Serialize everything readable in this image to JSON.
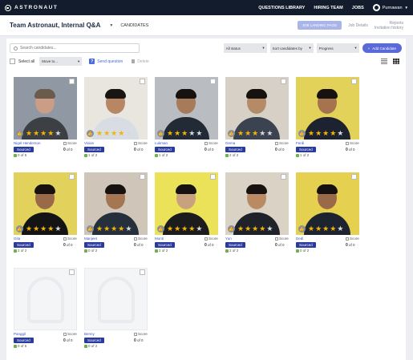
{
  "brand": {
    "name": "ASTRONAUT"
  },
  "topnav": {
    "questions": "QUESTIONS LIBRARY",
    "hiring": "HIRING TEAM",
    "jobs": "JOBS",
    "user": "Purnawan"
  },
  "subheader": {
    "team_title": "Team Astronaut, Internal Q&A",
    "candidates_tab": "CANDIDATES",
    "job_landing": "JOB LANDING PAGE",
    "job_details": "Job Details",
    "reports": "Reports",
    "invitation_history": "Invitation history"
  },
  "toolbar": {
    "search_placeholder": "Search candidates...",
    "status": "All status",
    "sort": "Sort candidates by",
    "progress": "Progress",
    "add": "Add Candidate",
    "select_all": "Select all",
    "move_to": "Move to...",
    "send_question": "Send question",
    "delete": "Delete"
  },
  "card_labels": {
    "status": "Sourced",
    "score": "Score",
    "of": "of 0"
  },
  "candidates": [
    {
      "name": "Nigel Henderson",
      "answered": "0 of 5",
      "score": "0",
      "rating": 4,
      "skin": "#c99d86",
      "shirt": "#3c3f44",
      "bg": "#8f98a3",
      "hair": "#6b5b4a"
    },
    {
      "name": "Vivian",
      "answered": "1 of 2",
      "score": "0",
      "rating": 4,
      "skin": "#b78763",
      "shirt": "#d8dde4",
      "bg": "#e9e5df",
      "hair": "#1a1512"
    },
    {
      "name": "Lukman",
      "answered": "1 of 2",
      "score": "0",
      "rating": 3,
      "skin": "#a77a59",
      "shirt": "#222a36",
      "bg": "#b9bcc0",
      "hair": "#17120f"
    },
    {
      "name": "Gema",
      "answered": "2 of 2",
      "score": "0",
      "rating": 3,
      "skin": "#b58a66",
      "shirt": "#3b4350",
      "bg": "#d7d0c6",
      "hair": "#17120f"
    },
    {
      "name": "Ferdi",
      "answered": "1 of 2",
      "score": "0",
      "rating": 4,
      "skin": "#a5744f",
      "shirt": "#1c2230",
      "bg": "#e3d25a",
      "hair": "#17120f"
    },
    {
      "name": "Gita",
      "answered": "2 of 2",
      "score": "0",
      "rating": 4,
      "skin": "#9a6a48",
      "shirt": "#141414",
      "bg": "#e2d25c",
      "hair": "#17120f"
    },
    {
      "name": "Manjeet",
      "answered": "0 of 2",
      "score": "0",
      "rating": 4,
      "skin": "#a67552",
      "shirt": "#26303d",
      "bg": "#cfc6b9",
      "hair": "#17120f"
    },
    {
      "name": "Monti",
      "answered": "2 of 2",
      "score": "0",
      "rating": 4,
      "skin": "#c9a17f",
      "shirt": "#1c1c1c",
      "bg": "#ece25a",
      "hair": "#17120f"
    },
    {
      "name": "Yun",
      "answered": "2 of 2",
      "score": "0",
      "rating": 4,
      "skin": "#b98a64",
      "shirt": "#1f2228",
      "bg": "#d9d2c5",
      "hair": "#17120f"
    },
    {
      "name": "Dedi",
      "answered": "0 of 2",
      "score": "0",
      "rating": 4,
      "skin": "#9a6a48",
      "shirt": "#1e2330",
      "bg": "#e5d04f",
      "hair": "#17120f"
    },
    {
      "name": "Panggil",
      "answered": "0 of 5",
      "score": "0",
      "rating": 0,
      "empty": true
    },
    {
      "name": "Benny",
      "answered": "0 of 2",
      "score": "0",
      "rating": 0,
      "empty": true
    }
  ]
}
